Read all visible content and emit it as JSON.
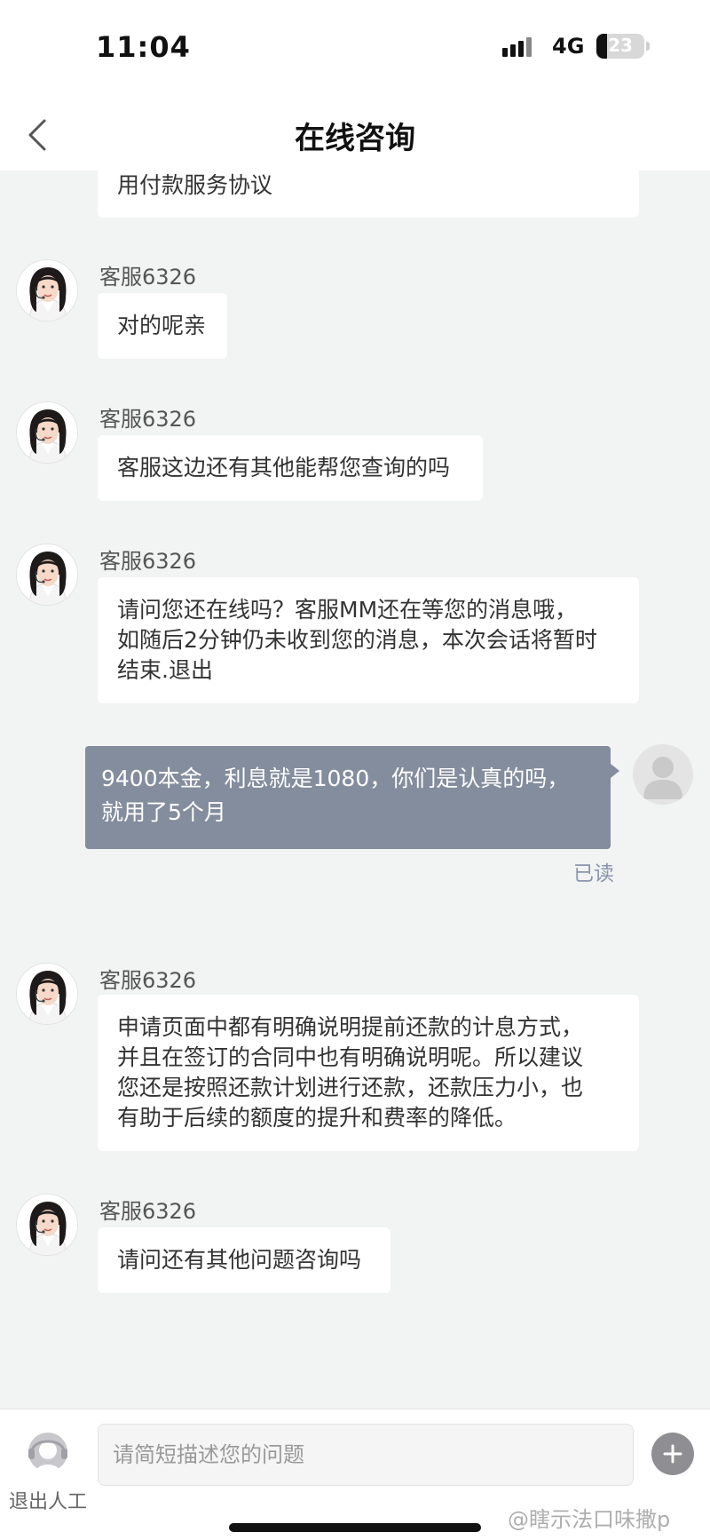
{
  "status_bar": {
    "time": "11:04",
    "network": "4G",
    "battery": "23"
  },
  "header": {
    "title": "在线咨询"
  },
  "messages": [
    {
      "text": "用付款服务协议"
    },
    {
      "agent": "客服6326",
      "text": "对的呢亲"
    },
    {
      "agent": "客服6326",
      "text": "客服这边还有其他能帮您查询的吗"
    },
    {
      "agent": "客服6326",
      "lines": [
        "请问您还在线吗？客服MM还在等您的消息哦，",
        "如随后2分钟仍未收到您的消息，本次会话将暂时",
        "结束.退出"
      ]
    },
    {
      "user": true,
      "lines": [
        "9400本金，利息就是1080，你们是认真的吗，",
        "就用了5个月"
      ],
      "status": "已读"
    },
    {
      "agent": "客服6326",
      "lines": [
        "申请页面中都有明确说明提前还款的计息方式，",
        "并且在签订的合同中也有明确说明呢。所以建议",
        "您还是按照还款计划进行还款，还款压力小，也",
        "有助于后续的额度的提升和费率的降低。"
      ]
    },
    {
      "agent": "客服6326",
      "text": "请问还有其他问题咨询吗"
    }
  ],
  "bottom_bar": {
    "exit_label": "退出人工",
    "input_placeholder": "请简短描述您的问题",
    "watermark": "@瞎示法口味撒p"
  },
  "colors": {
    "user_bubble": "#848d9e",
    "read_status": "#8a96ad",
    "background": "#f2f3f3"
  }
}
